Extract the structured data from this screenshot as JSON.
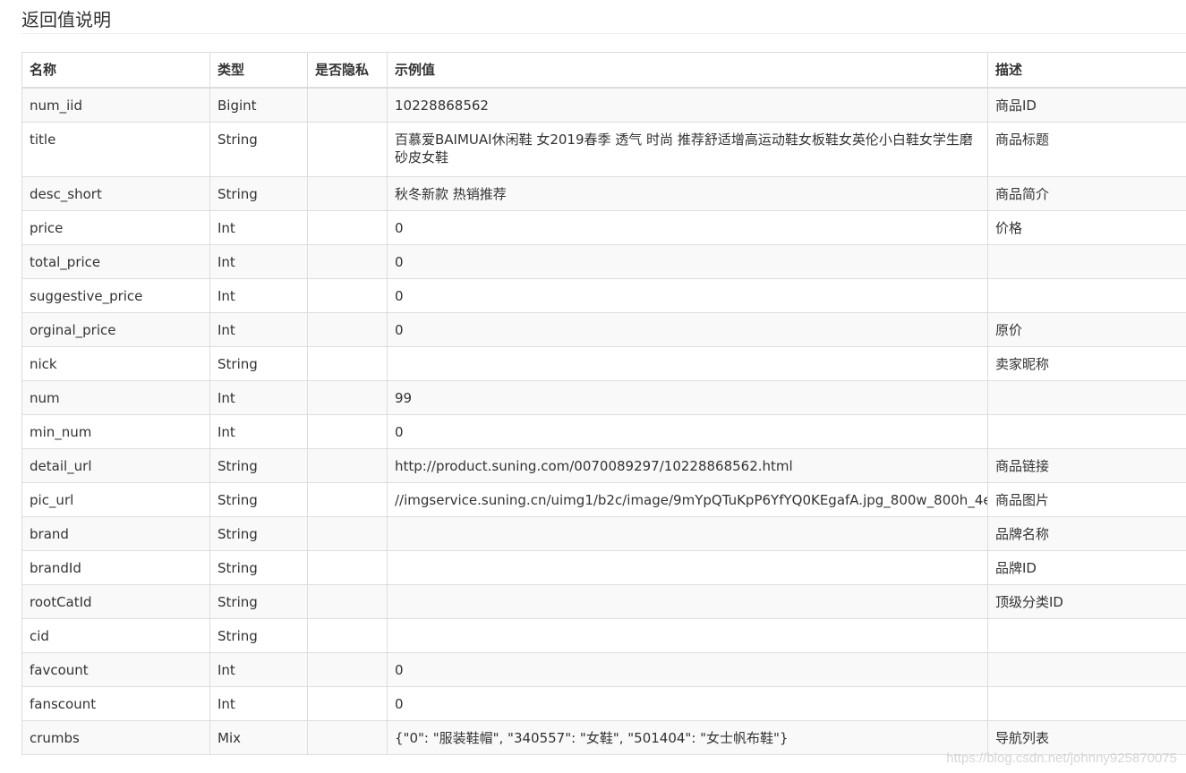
{
  "page": {
    "title": "返回值说明"
  },
  "table": {
    "headers": [
      "名称",
      "类型",
      "是否隐私",
      "示例值",
      "描述"
    ],
    "rows": [
      {
        "name": "num_iid",
        "type": "Bigint",
        "private": "",
        "example": "10228868562",
        "desc": "商品ID"
      },
      {
        "name": "title",
        "type": "String",
        "private": "",
        "example": "百慕爱BAIMUAI休闲鞋 女2019春季 透气 时尚 推荐舒适增高运动鞋女板鞋女英伦小白鞋女学生磨砂皮女鞋",
        "desc": "商品标题"
      },
      {
        "name": "desc_short",
        "type": "String",
        "private": "",
        "example": "秋冬新款 热销推荐",
        "desc": "商品简介"
      },
      {
        "name": "price",
        "type": "Int",
        "private": "",
        "example": "0",
        "desc": "价格"
      },
      {
        "name": "total_price",
        "type": "Int",
        "private": "",
        "example": "0",
        "desc": ""
      },
      {
        "name": "suggestive_price",
        "type": "Int",
        "private": "",
        "example": "0",
        "desc": ""
      },
      {
        "name": "orginal_price",
        "type": "Int",
        "private": "",
        "example": "0",
        "desc": "原价"
      },
      {
        "name": "nick",
        "type": "String",
        "private": "",
        "example": "",
        "desc": "卖家昵称"
      },
      {
        "name": "num",
        "type": "Int",
        "private": "",
        "example": "99",
        "desc": ""
      },
      {
        "name": "min_num",
        "type": "Int",
        "private": "",
        "example": "0",
        "desc": ""
      },
      {
        "name": "detail_url",
        "type": "String",
        "private": "",
        "example": "http://product.suning.com/0070089297/10228868562.html",
        "desc": "商品链接"
      },
      {
        "name": "pic_url",
        "type": "String",
        "private": "",
        "example": "//imgservice.suning.cn/uimg1/b2c/image/9mYpQTuKpP6YfYQ0KEgafA.jpg_800w_800h_4e",
        "desc": "商品图片"
      },
      {
        "name": "brand",
        "type": "String",
        "private": "",
        "example": "",
        "desc": "品牌名称"
      },
      {
        "name": "brandId",
        "type": "String",
        "private": "",
        "example": "",
        "desc": "品牌ID"
      },
      {
        "name": "rootCatId",
        "type": "String",
        "private": "",
        "example": "",
        "desc": "顶级分类ID"
      },
      {
        "name": "cid",
        "type": "String",
        "private": "",
        "example": "",
        "desc": ""
      },
      {
        "name": "favcount",
        "type": "Int",
        "private": "",
        "example": "0",
        "desc": ""
      },
      {
        "name": "fanscount",
        "type": "Int",
        "private": "",
        "example": "0",
        "desc": ""
      },
      {
        "name": "crumbs",
        "type": "Mix",
        "private": "",
        "example": "{\"0\": \"服装鞋帽\", \"340557\": \"女鞋\", \"501404\": \"女士帆布鞋\"}",
        "desc": "导航列表"
      }
    ]
  },
  "watermark": "https://blog.csdn.net/johnny925870075"
}
